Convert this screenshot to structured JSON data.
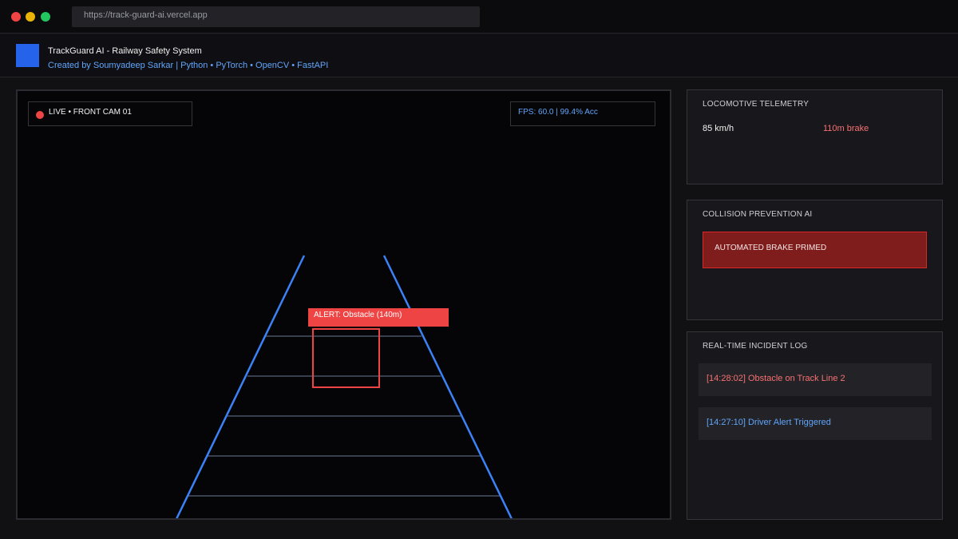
{
  "browser": {
    "url": "https://track-guard-ai.vercel.app"
  },
  "app": {
    "title": "TrackGuard AI - Railway Safety System",
    "subtitle": "Created by Soumyadeep Sarkar | Python • PyTorch • OpenCV • FastAPI"
  },
  "camera": {
    "live_label": "LIVE • FRONT CAM 01",
    "fps_label": "FPS: 60.0 | 99.4% Acc",
    "alert_label": "ALERT: Obstacle (140m)"
  },
  "telemetry": {
    "title": "LOCOMOTIVE TELEMETRY",
    "speed": "85 km/h",
    "brake": "110m brake"
  },
  "collision": {
    "title": "COLLISION PREVENTION AI",
    "status": "AUTOMATED BRAKE PRIMED"
  },
  "incident_log": {
    "title": "REAL-TIME INCIDENT LOG",
    "items": [
      "[14:28:02] Obstacle on Track Line 2",
      "[14:27:10] Driver Alert Triggered"
    ]
  },
  "colors": {
    "accent_blue": "#2563eb",
    "alert_red": "#ef4444",
    "brake_bg": "#7f1d1d",
    "background": "#111114"
  },
  "icons": {
    "window_controls": [
      "close-dot",
      "minimize-dot",
      "maximize-dot"
    ],
    "live_indicator": "recording-dot-icon"
  }
}
